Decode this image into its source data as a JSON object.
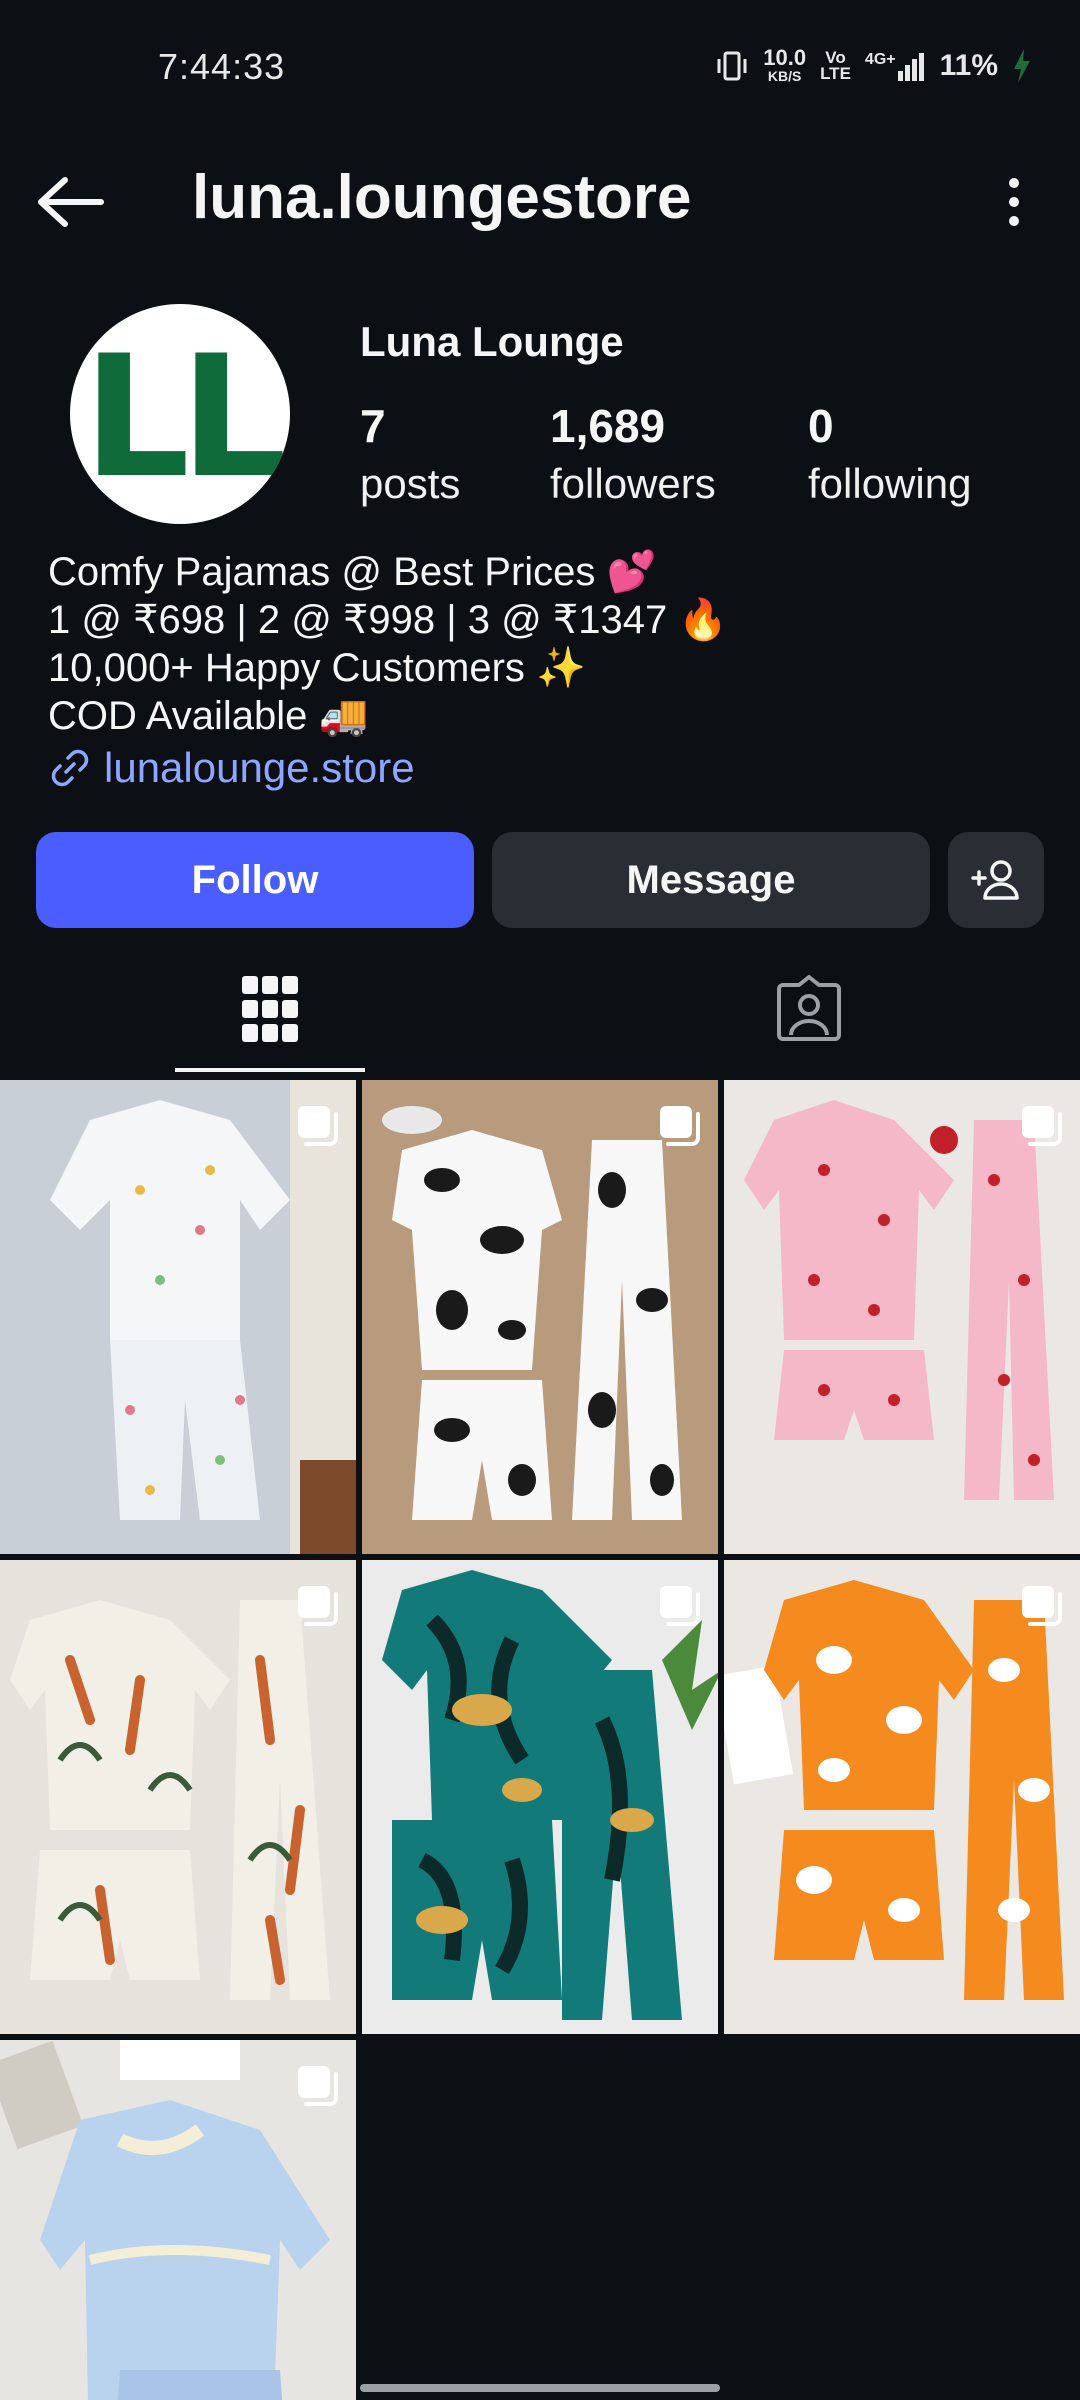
{
  "status_bar": {
    "time": "7:44:33",
    "net_speed_value": "10.0",
    "net_speed_unit": "KB/S",
    "volte_top": "Vo",
    "volte_bottom": "LTE",
    "network": "4G+",
    "battery": "11%"
  },
  "header": {
    "username": "luna.loungestore",
    "back_icon": "arrow-left-icon",
    "more_icon": "more-vertical-icon"
  },
  "profile": {
    "avatar_initials": "LL",
    "display_name": "Luna Lounge",
    "stats": [
      {
        "value": "7",
        "label": "posts"
      },
      {
        "value": "1,689",
        "label": "followers"
      },
      {
        "value": "0",
        "label": "following"
      }
    ],
    "bio_lines": [
      "Comfy Pajamas @ Best Prices 💕",
      "1 @ ₹698 | 2 @ ₹998 | 3 @ ₹1347 🔥",
      "10,000+ Happy Customers ✨",
      "COD Available 🚚"
    ],
    "link": "lunalounge.store"
  },
  "actions": {
    "follow_label": "Follow",
    "message_label": "Message",
    "suggest_icon": "add-person-icon",
    "follow_color": "#4a5dff"
  },
  "tabs": [
    {
      "name": "posts-grid",
      "icon": "grid-icon",
      "active": true
    },
    {
      "name": "tagged",
      "icon": "tagged-user-icon",
      "active": false
    }
  ],
  "posts": [
    {
      "desc": "white checkered pajama set",
      "multi": true
    },
    {
      "desc": "cow print pajama set",
      "multi": true
    },
    {
      "desc": "pink heart pajama set",
      "multi": true
    },
    {
      "desc": "giraffe tropical pajama set",
      "multi": true
    },
    {
      "desc": "leopard teal pajama set",
      "multi": true
    },
    {
      "desc": "orange ghost pajama set",
      "multi": true
    },
    {
      "desc": "light blue ruffle pajama set",
      "multi": true
    }
  ]
}
